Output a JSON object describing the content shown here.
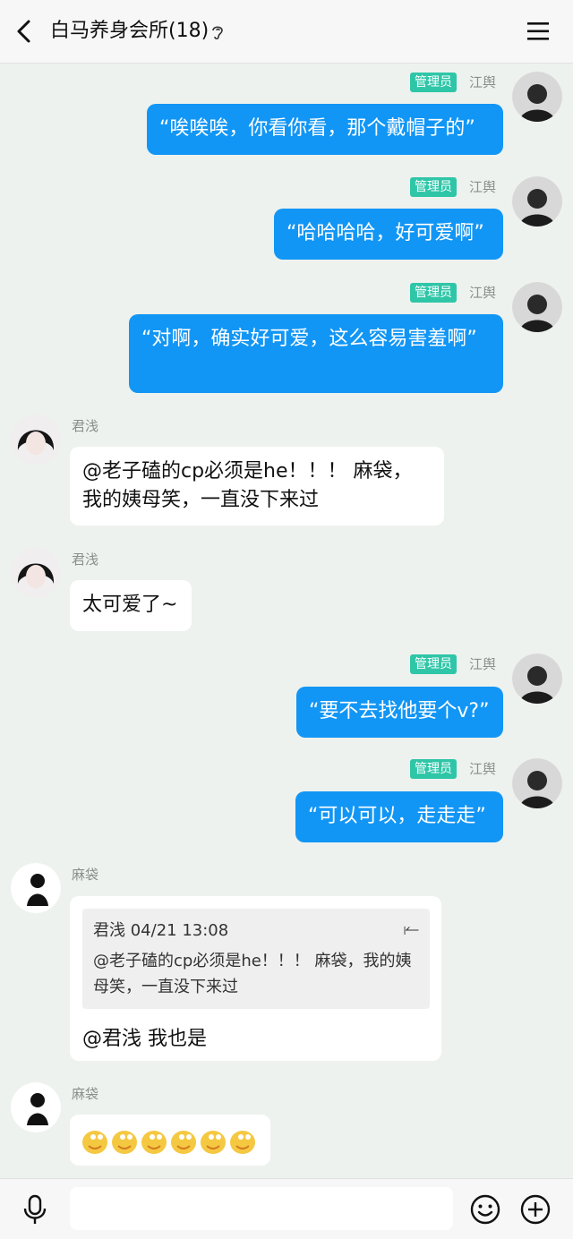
{
  "header": {
    "title": "白马养身会所(18)"
  },
  "admin_badge": "管理员",
  "messages": [
    {
      "sender": "江舆",
      "text": "“唉唉唉，你看你看，那个戴帽子的”"
    },
    {
      "sender": "江舆",
      "text": "“哈哈哈哈，好可爱啊”"
    },
    {
      "sender": "江舆",
      "text": "“对啊，确实好可爱，这么容易害羞啊”"
    },
    {
      "sender": "君浅",
      "text": "@老子磕的cp必须是he！！！ 麻袋，我的姨母笑，一直没下来过"
    },
    {
      "sender": "君浅",
      "text": "太可爱了~"
    },
    {
      "sender": "江舆",
      "text": "“要不去找他要个v?”"
    },
    {
      "sender": "江舆",
      "text": "“可以可以，走走走”"
    },
    {
      "sender": "麻袋",
      "quote_meta": "君浅 04/21 13:08",
      "quote_text": "@老子磕的cp必须是he！！！ 麻袋，我的姨母笑，一直没下来过",
      "text": "@君浅 我也是"
    },
    {
      "sender": "麻袋",
      "emoji_count": 6
    }
  ],
  "colors": {
    "background": "#edf2ee",
    "outgoing_bubble": "#1296f5",
    "incoming_bubble": "#ffffff",
    "admin_badge": "#2fc6a8"
  }
}
